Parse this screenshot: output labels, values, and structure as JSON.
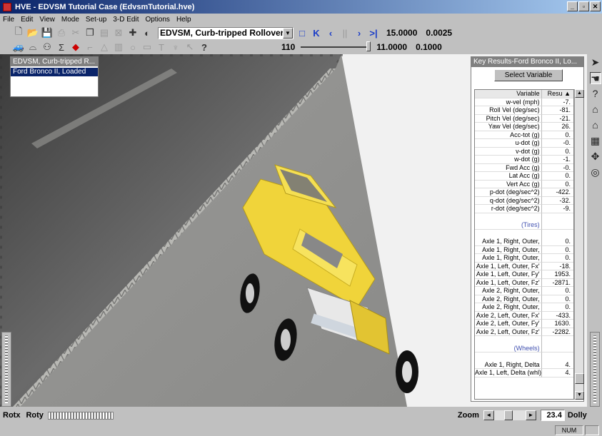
{
  "window": {
    "title": "HVE - EDVSM Tutorial Case (EdvsmTutorial.hve)",
    "buttons": {
      "minimize": "_",
      "maximize": "▫",
      "close": "✕"
    }
  },
  "menu": [
    "File",
    "Edit",
    "View",
    "Mode",
    "Set-up",
    "3-D Edit",
    "Options",
    "Help"
  ],
  "toolbar": {
    "event_combo": "EDVSM, Curb-tripped Rollover",
    "combo_arrow": "▼",
    "playback": [
      "□",
      "K",
      "‹",
      "||",
      "›",
      ">|"
    ],
    "time": "15.0000",
    "time_step": "0.0025",
    "frame": "110",
    "time2": "11.0000",
    "step2": "0.1000",
    "help_glyph": "?"
  },
  "event_panel": {
    "header": "EDVSM, Curb-tripped R...",
    "selected_item": "Ford Bronco II, Loaded"
  },
  "key_results": {
    "header": "Key Results-Ford Bronco II, Lo...",
    "select_button": "Select Variable",
    "col_variable": "Variable",
    "col_result": "Resu ▲",
    "rows": [
      {
        "v": "w-vel (mph)",
        "r": "-7."
      },
      {
        "v": "Roll Vel (deg/sec)",
        "r": "-81."
      },
      {
        "v": "Pitch Vel (deg/sec)",
        "r": "-21."
      },
      {
        "v": "Yaw Vel (deg/sec)",
        "r": "26."
      },
      {
        "v": "Acc-tot (g)",
        "r": "0."
      },
      {
        "v": "u-dot (g)",
        "r": "-0."
      },
      {
        "v": "v-dot (g)",
        "r": "0."
      },
      {
        "v": "w-dot (g)",
        "r": "-1."
      },
      {
        "v": "Fwd Acc (g)",
        "r": "-0."
      },
      {
        "v": "Lat Acc (g)",
        "r": "0."
      },
      {
        "v": "Vert Acc (g)",
        "r": "0."
      },
      {
        "v": "p-dot (deg/sec^2)",
        "r": "-422."
      },
      {
        "v": "q-dot (deg/sec^2)",
        "r": "-32."
      },
      {
        "v": "r-dot (deg/sec^2)",
        "r": "-9."
      },
      {
        "v": "",
        "r": "",
        "kind": "blank"
      },
      {
        "v": "(Tires)",
        "r": "",
        "kind": "section"
      },
      {
        "v": "",
        "r": "",
        "kind": "blank"
      },
      {
        "v": "Axle 1, Right, Outer,",
        "r": "0."
      },
      {
        "v": "Axle 1, Right, Outer,",
        "r": "0."
      },
      {
        "v": "Axle 1, Right, Outer,",
        "r": "0."
      },
      {
        "v": "Axle 1, Left, Outer, Fx'",
        "r": "-18."
      },
      {
        "v": "Axle 1, Left, Outer, Fy'",
        "r": "1953."
      },
      {
        "v": "Axle 1, Left, Outer, Fz'",
        "r": "-2871."
      },
      {
        "v": "Axle 2, Right, Outer,",
        "r": "0."
      },
      {
        "v": "Axle 2, Right, Outer,",
        "r": "0."
      },
      {
        "v": "Axle 2, Right, Outer,",
        "r": "0."
      },
      {
        "v": "Axle 2, Left, Outer, Fx'",
        "r": "-433."
      },
      {
        "v": "Axle 2, Left, Outer, Fy'",
        "r": "1630."
      },
      {
        "v": "Axle 2, Left, Outer, Fz'",
        "r": "-2282."
      },
      {
        "v": "",
        "r": "",
        "kind": "blank"
      },
      {
        "v": "(Wheels)",
        "r": "",
        "kind": "section"
      },
      {
        "v": "",
        "r": "",
        "kind": "blank"
      },
      {
        "v": "Axle 1, Right, Delta",
        "r": "4."
      },
      {
        "v": "Axle 1, Left, Delta (whl)",
        "r": "4."
      }
    ]
  },
  "bottom": {
    "rotx": "Rotx",
    "roty": "Roty",
    "zoom_label": "Zoom",
    "zoom_value": "23.4",
    "dolly_label": "Dolly"
  },
  "status": {
    "num": "NUM"
  },
  "colors": {
    "title_start": "#0a246a",
    "title_end": "#a6caf0",
    "vehicle": "#f2dc3a",
    "chrome": "#c0c0c0"
  }
}
